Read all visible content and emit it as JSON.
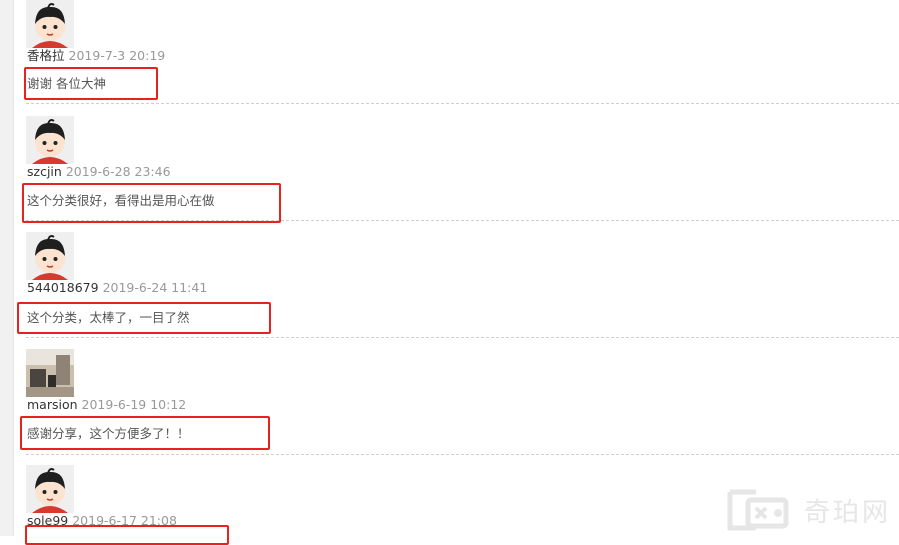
{
  "comments": [
    {
      "user": "香格拉",
      "time": "2019-7-3 20:19",
      "text": "谢谢  各位大神",
      "avatar": "cartoon-avatar-icon"
    },
    {
      "user": "szcjin",
      "time": "2019-6-28 23:46",
      "text": "这个分类很好，看得出是用心在做",
      "avatar": "cartoon-avatar-icon"
    },
    {
      "user": "544018679",
      "time": "2019-6-24 11:41",
      "text": "这个分类，太棒了，一目了然",
      "avatar": "cartoon-avatar-icon"
    },
    {
      "user": "marsion",
      "time": "2019-6-19 10:12",
      "text": "感谢分享，这个方便多了！！",
      "avatar": "photo-avatar"
    },
    {
      "user": "sole99",
      "time": "2019-6-17 21:08",
      "text": "",
      "avatar": "cartoon-avatar-icon"
    }
  ],
  "watermark": {
    "text": "奇珀网"
  },
  "colors": {
    "highlight": "#e8221f",
    "time": "#999999",
    "divider": "#cfcfcf"
  }
}
